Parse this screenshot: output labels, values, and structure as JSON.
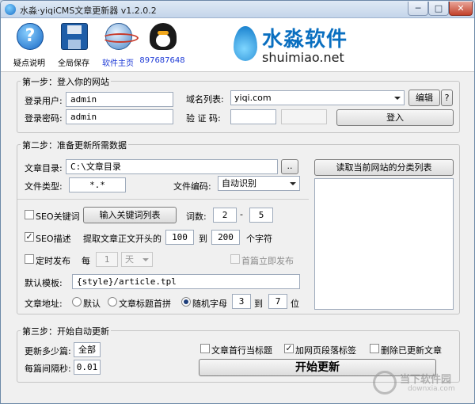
{
  "window": {
    "title": "水淼·yiqiCMS文章更新器 v1.2.0.2",
    "minimize": "─",
    "maximize": "□",
    "close": "✕"
  },
  "toolbar": {
    "help": "疑点说明",
    "save": "全局保存",
    "home": "软件主页",
    "qq": "897687648",
    "help_glyph": "?"
  },
  "logo": {
    "cn": "水淼软件",
    "en": "shuimiao.net"
  },
  "step1": {
    "title": "第一步：登入你的网站",
    "user_label": "登录用户:",
    "user_value": "admin",
    "password_label": "登录密码:",
    "password_value": "admin",
    "domain_label": "域名列表:",
    "domain_value": "yiqi.com",
    "edit_button": "编辑",
    "help_button": "?",
    "captcha_label": "验 证 码:",
    "captcha_value": "",
    "login_button": "登入"
  },
  "step2": {
    "title": "第二步：准备更新所需数据",
    "dir_label": "文章目录:",
    "dir_value": "C:\\文章目录",
    "browse_button": "..",
    "type_label": "文件类型:",
    "type_value": "*.*",
    "encoding_label": "文件编码:",
    "encoding_value": "自动识别",
    "read_categories_button": "读取当前网站的分类列表",
    "seo_keywords_label": "SEO关键词",
    "seo_keywords_checked": false,
    "input_keywords_button": "输入关键词列表",
    "word_count_label": "词数:",
    "word_min": "2",
    "dash": "-",
    "word_max": "5",
    "seo_desc_label": "SEO描述",
    "seo_desc_checked": true,
    "extract_label": "提取文章正文开头的",
    "extract_from": "100",
    "to_label": "到",
    "extract_to": "200",
    "chars_label": "个字符",
    "schedule_label": "定时发布",
    "schedule_checked": false,
    "every_label": "每",
    "every_value": "1",
    "unit_value": "天",
    "first_publish_label": "首篇立即发布",
    "template_label": "默认模板:",
    "template_value": "{style}/article.tpl",
    "address_label": "文章地址:",
    "address_default": "默认",
    "address_pinyin": "文章标题首拼",
    "address_random": "随机字母",
    "random_from": "3",
    "random_to_label": "到",
    "random_to": "7",
    "digit_label": "位"
  },
  "step3": {
    "title": "第三步：开始自动更新",
    "count_label": "更新多少篇:",
    "count_value": "全部",
    "interval_label": "每篇间隔秒:",
    "interval_value": "0.01",
    "first_line_title": "文章首行当标题",
    "first_line_title_checked": false,
    "add_paragraph_tags": "加网页段落标签",
    "add_paragraph_tags_checked": true,
    "delete_updated": "删除已更新文章",
    "delete_updated_checked": false,
    "start_button": "开始更新"
  },
  "watermark": {
    "cn": "当下软件园",
    "en": "downxia.com"
  },
  "colors": {
    "accent": "#1c39d6",
    "logo_blue": "#0a6fc0"
  }
}
